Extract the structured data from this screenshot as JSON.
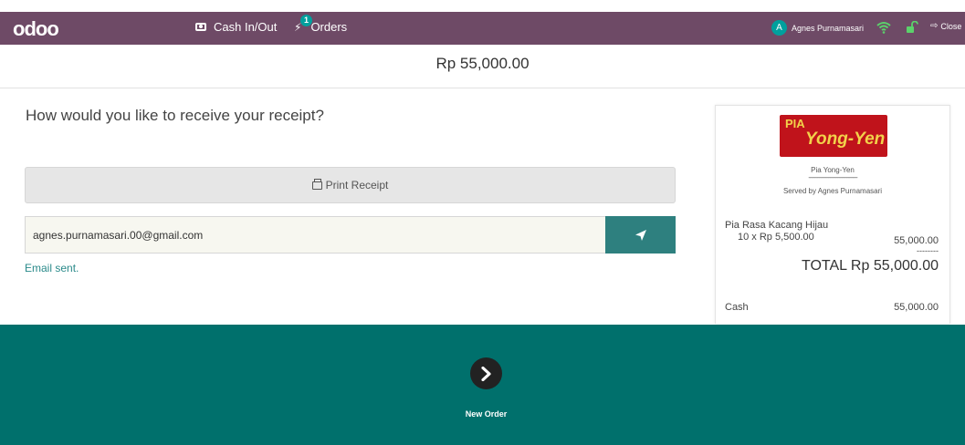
{
  "topbar": {
    "logo": "odoo",
    "cash_label": "Cash In/Out",
    "orders_label": "Orders",
    "orders_badge": "1",
    "user_initial": "A",
    "user_name": "Agnes Purnamasari",
    "close_label": "Close"
  },
  "payment": {
    "amount": "Rp 55,000.00"
  },
  "receipt_screen": {
    "question": "How would you like to receive your receipt?",
    "print_label": "Print Receipt",
    "email_value": "agnes.purnamasari.00@gmail.com",
    "status": "Email sent."
  },
  "receipt": {
    "logo_top": "PIA",
    "logo_name": "Yong-Yen",
    "shop_name": "Pia Yong-Yen",
    "separator": "--------------------------------",
    "served_by": "Served by Agnes Purnamasari",
    "item_name": "Pia Rasa Kacang Hijau",
    "item_qty": "10 x Rp 5,500.00",
    "item_total": "55,000.00",
    "total_dashes": "--------",
    "total": "TOTAL Rp 55,000.00",
    "payment_method": "Cash",
    "payment_amount": "55,000.00"
  },
  "footer": {
    "new_order_label": "New Order"
  },
  "colors": {
    "topbar": "#6e4a66",
    "accent": "#00a09d",
    "send_button": "#2e807f",
    "footer": "#00706c"
  },
  "icons": [
    "cash-icon",
    "orders-icon",
    "wifi-icon",
    "lock-icon",
    "sign-out-icon",
    "printer-icon",
    "send-icon",
    "chevron-right-icon"
  ]
}
